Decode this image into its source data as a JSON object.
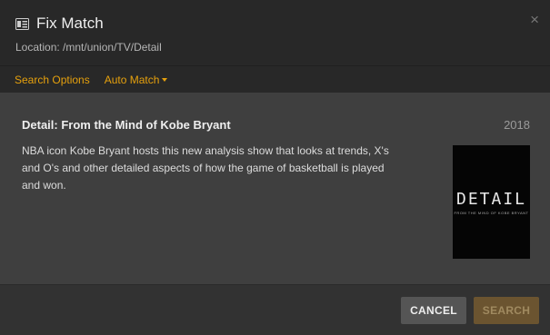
{
  "dialog": {
    "title": "Fix Match",
    "location": "Location: /mnt/union/TV/Detail",
    "close_symbol": "×",
    "title_icon": "tv-guide-icon"
  },
  "options": {
    "search_options": "Search Options",
    "auto_match": "Auto Match",
    "accent_color": "#e5a00d"
  },
  "result": {
    "title": "Detail: From the Mind of Kobe Bryant",
    "year": "2018",
    "description": "NBA icon Kobe Bryant hosts this new analysis show that looks at trends, X's and O's and other detailed aspects of how the game of basketball is played and won.",
    "poster": {
      "title": "DETAIL",
      "subtitle": "FROM THE MIND OF KOBE BRYANT"
    }
  },
  "footer": {
    "cancel_label": "CANCEL",
    "search_label": "SEARCH"
  }
}
